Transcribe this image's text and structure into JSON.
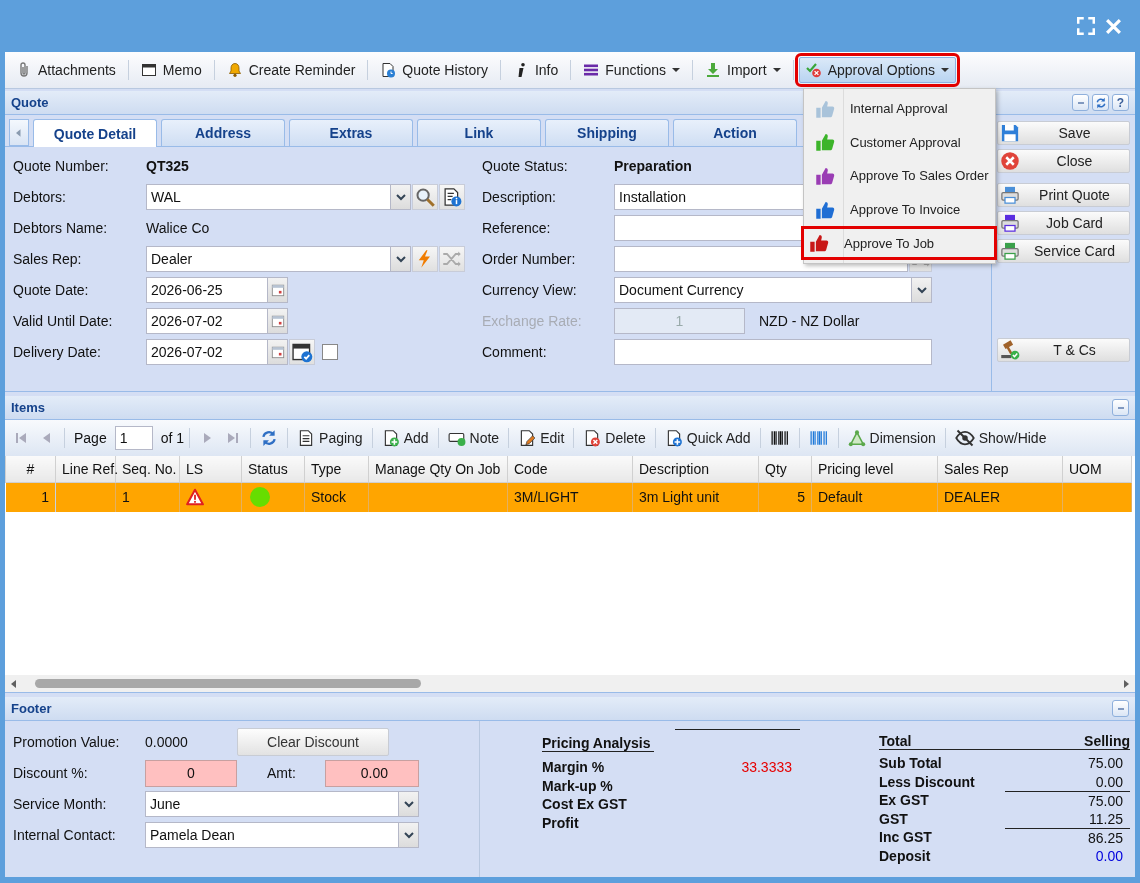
{
  "toolbar": [
    {
      "label": "Attachments",
      "kind": "button",
      "highlighted": false
    },
    {
      "label": "Memo",
      "kind": "button",
      "highlighted": false
    },
    {
      "label": "Create Reminder",
      "kind": "button",
      "highlighted": false
    },
    {
      "label": "Quote History",
      "kind": "button",
      "highlighted": false
    },
    {
      "label": "Info",
      "kind": "button",
      "highlighted": false
    },
    {
      "label": "Functions",
      "kind": "menu",
      "highlighted": false
    },
    {
      "label": "Import",
      "kind": "menu",
      "highlighted": false
    },
    {
      "label": "Approval Options",
      "kind": "menu",
      "highlighted": true
    }
  ],
  "approval_menu": [
    {
      "label": "Internal Approval",
      "color": "#a9c3da",
      "highlighted": false
    },
    {
      "label": "Customer Approval",
      "color": "#3cb42a",
      "highlighted": false
    },
    {
      "label": "Approve To Sales Order",
      "color": "#9a3db4",
      "highlighted": false
    },
    {
      "label": "Approve To Invoice",
      "color": "#1f6ed4",
      "highlighted": false
    },
    {
      "label": "Approve To Job",
      "color": "#c81818",
      "highlighted": true
    }
  ],
  "quote": {
    "title": "Quote",
    "help": "?",
    "tabs": [
      {
        "label": "Quote Detail",
        "selected": true
      },
      {
        "label": "Address",
        "selected": false
      },
      {
        "label": "Extras",
        "selected": false
      },
      {
        "label": "Link",
        "selected": false
      },
      {
        "label": "Shipping",
        "selected": false
      },
      {
        "label": "Action",
        "selected": false
      }
    ],
    "left_fields": [
      {
        "label": "Quote Number:",
        "value": "QT325",
        "kind": "value"
      },
      {
        "label": "Debtors:",
        "value": "WAL",
        "kind": "lookup"
      },
      {
        "label": "Debtors Name:",
        "value": "Walice Co",
        "kind": "text"
      },
      {
        "label": "Sales Rep:",
        "value": "Dealer",
        "kind": "rep"
      },
      {
        "label": "Quote Date:",
        "value": "2026-06-25",
        "kind": "date"
      },
      {
        "label": "Valid Until Date:",
        "value": "2026-07-02",
        "kind": "date"
      },
      {
        "label": "Delivery Date:",
        "value": "2026-07-02",
        "kind": "schedule",
        "checked": false
      }
    ],
    "right_fields": [
      {
        "label": "Quote Status:",
        "value": "Preparation",
        "kind": "value"
      },
      {
        "label": "Description:",
        "value": "Installation",
        "kind": "input"
      },
      {
        "label": "Reference:",
        "kind": "input"
      },
      {
        "label": "Order Number:",
        "kind": "input-action"
      },
      {
        "label": "Currency View:",
        "value": "Document Currency",
        "kind": "select"
      },
      {
        "label": "Exchange Rate:",
        "value": "1",
        "kind": "rate",
        "disabled": true,
        "currency": "NZD - NZ Dollar"
      },
      {
        "label": "Comment:",
        "kind": "input"
      }
    ],
    "side_buttons": [
      {
        "label": "Save",
        "kind": "save"
      },
      {
        "label": "Close",
        "kind": "close"
      },
      {
        "label": "Print Quote",
        "kind": "print",
        "color": "#4a8fd8",
        "separated": true
      },
      {
        "label": "Job Card",
        "kind": "print",
        "color": "#5a2ee0"
      },
      {
        "label": "Service Card",
        "kind": "print",
        "color": "#3aa04a"
      },
      {
        "label": "T & Cs",
        "kind": "terms",
        "separated": true
      }
    ]
  },
  "items": {
    "title": "Items",
    "pager": {
      "label": "Page",
      "page": "1",
      "of": "of 1"
    },
    "tools": [
      {
        "label": "Paging",
        "kind": "paging"
      },
      {
        "label": "Add",
        "kind": "add"
      },
      {
        "label": "Note",
        "kind": "note"
      },
      {
        "label": "Edit",
        "kind": "edit"
      },
      {
        "label": "Delete",
        "kind": "delete"
      },
      {
        "label": "Quick Add",
        "kind": "quickadd"
      },
      {
        "kind": "barcode"
      },
      {
        "kind": "barcode-blue"
      },
      {
        "label": "Dimension",
        "kind": "dimension"
      },
      {
        "label": "Show/Hide",
        "kind": "showhide"
      }
    ],
    "columns": [
      "#",
      "Line Ref.",
      "Seq. No.",
      "LS",
      "Status",
      "Type",
      "Manage Qty On Job",
      "Code",
      "Description",
      "Qty",
      "Pricing level",
      "Sales Rep",
      "UOM"
    ],
    "rows": [
      {
        "number": "1",
        "seq_no": "1",
        "ls_warning": true,
        "color": "#66dd00",
        "type": "Stock",
        "code": "3M/LIGHT",
        "description": "3m Light unit",
        "qty": "5",
        "pricing_level": "Default",
        "sales_rep": "DEALER",
        "selected": true
      }
    ]
  },
  "footer": {
    "title": "Footer",
    "promotion": {
      "label": "Promotion Value:",
      "value": "0.0000"
    },
    "clear_button": "Clear Discount",
    "discount": {
      "label": "Discount %:",
      "value": "0"
    },
    "amount": {
      "label": "Amt:",
      "value": "0.00"
    },
    "service_month": {
      "label": "Service Month:",
      "value": "June"
    },
    "internal_contact": {
      "label": "Internal Contact:",
      "value": "Pamela Dean"
    },
    "analysis": {
      "title": "Pricing Analysis",
      "rows": [
        {
          "label": "Margin %",
          "value": "33.3333",
          "color": "#e60000"
        },
        {
          "label": "Mark-up %"
        },
        {
          "label": "Cost Ex GST"
        },
        {
          "label": "Profit"
        }
      ]
    },
    "totals": {
      "title": "Total",
      "column": "Selling",
      "rows": [
        {
          "label": "Sub Total",
          "value": "75.00"
        },
        {
          "label": "Less Discount",
          "value": "0.00"
        },
        {
          "label": "Ex GST",
          "value": "75.00",
          "rule_above": true
        },
        {
          "label": "GST",
          "value": "11.25"
        },
        {
          "label": "Inc GST",
          "value": "86.25",
          "rule_above": true
        },
        {
          "label": "Deposit",
          "value": "0.00",
          "color": "#0000dd"
        }
      ]
    }
  }
}
